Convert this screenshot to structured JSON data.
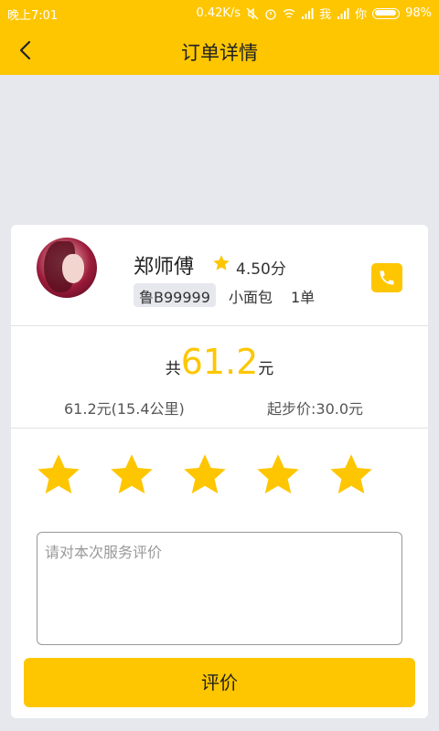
{
  "status_bar": {
    "time": "晚上7:01",
    "network_speed": "0.42K/s",
    "carrier1": "我",
    "carrier2": "你",
    "battery": "98%"
  },
  "header": {
    "title": "订单详情",
    "back_icon": "back-arrow-icon"
  },
  "driver": {
    "name": "郑师傅",
    "rating": "4.50分",
    "plate": "鲁B99999",
    "vehicle_type": "小面包",
    "order_count": "1单",
    "phone_icon": "phone-icon"
  },
  "fare": {
    "prefix": "共",
    "amount": "61.2",
    "suffix": "元",
    "detail": "61.2元(15.4公里)",
    "base_fare": "起步价:30.0元"
  },
  "review": {
    "star_count": 5,
    "placeholder": "请对本次服务评价",
    "submit_label": "评价"
  },
  "colors": {
    "accent": "#fec600",
    "background": "#e6e8ee"
  }
}
